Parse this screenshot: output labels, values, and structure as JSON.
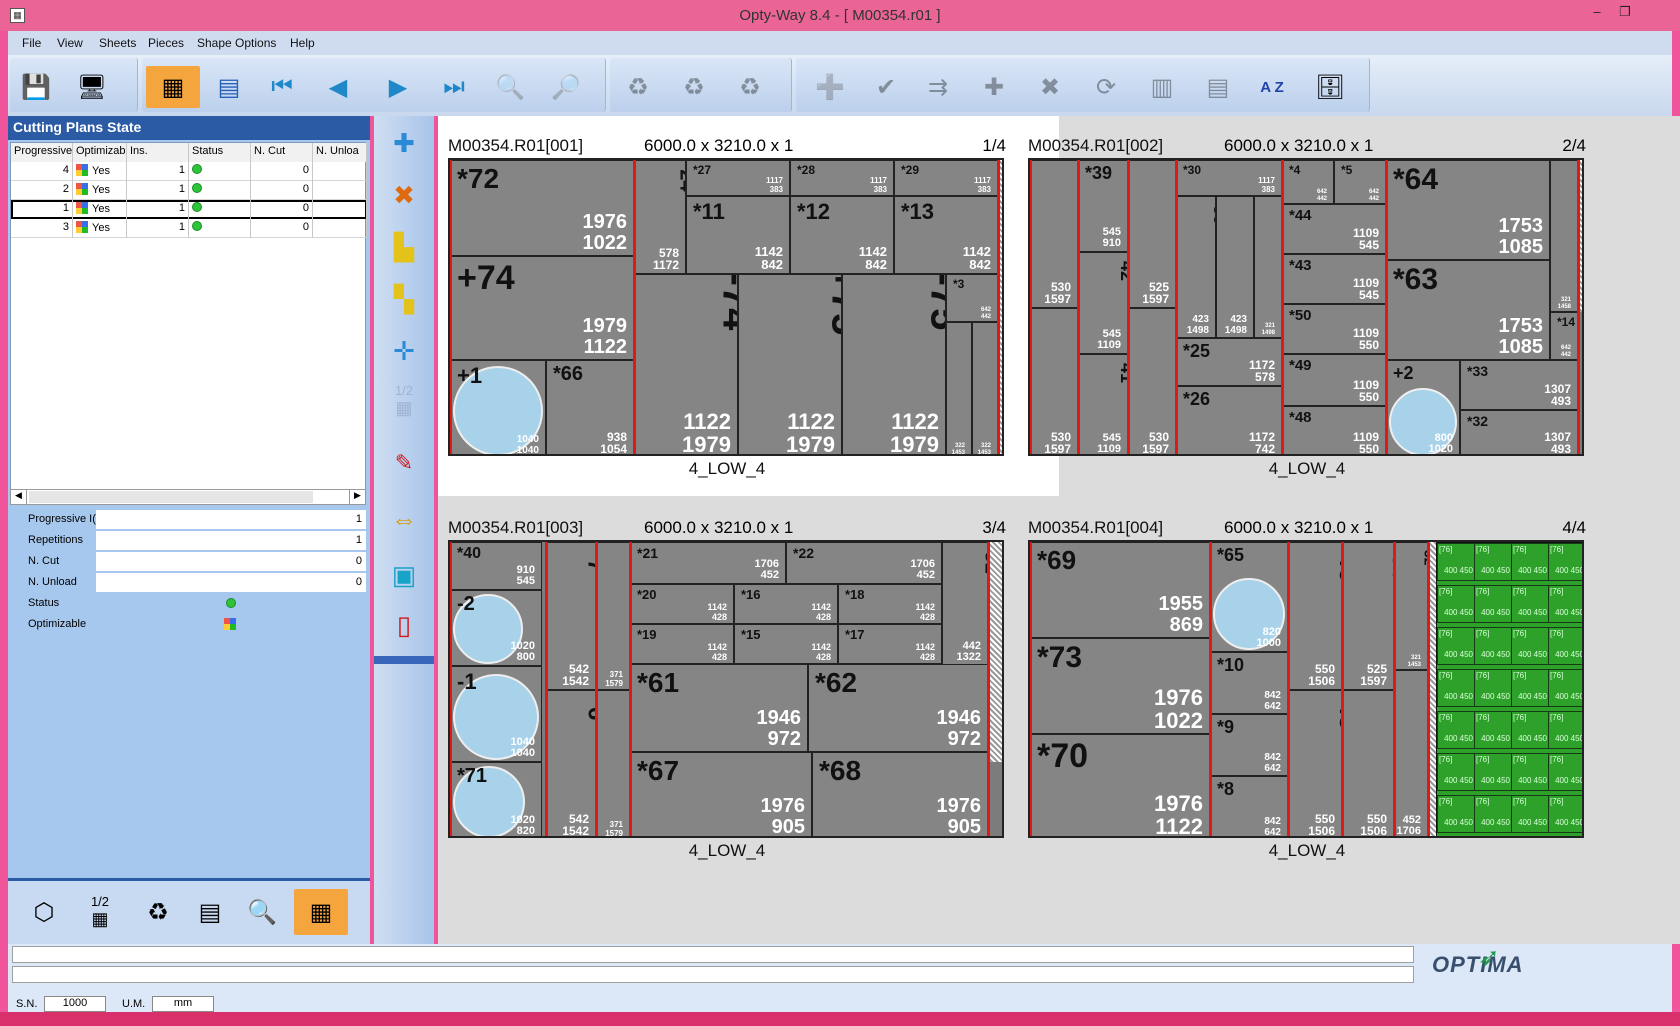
{
  "window": {
    "title": "Opty-Way 8.4  - [ M00354.r01 ]",
    "min": "–",
    "max": "❐"
  },
  "menu": [
    "File",
    "View",
    "Sheets",
    "Pieces",
    "Shape Options",
    "Help"
  ],
  "left": {
    "header": "Cutting Plans State",
    "columns": [
      "Progressive",
      "Optimizable",
      "Ins.",
      "Status",
      "N. Cut",
      "N. Unloa"
    ],
    "rows": [
      {
        "prog": "4",
        "opt": "Yes",
        "ins": "1",
        "cut": "0"
      },
      {
        "prog": "2",
        "opt": "Yes",
        "ins": "1",
        "cut": "0"
      },
      {
        "prog": "1",
        "opt": "Yes",
        "ins": "1",
        "cut": "0"
      },
      {
        "prog": "3",
        "opt": "Yes",
        "ins": "1",
        "cut": "0"
      }
    ],
    "props": [
      {
        "label": "Progressive I(",
        "value": "1"
      },
      {
        "label": "Repetitions",
        "value": "1"
      },
      {
        "label": "N. Cut",
        "value": "0"
      },
      {
        "label": "N. Unload",
        "value": "0"
      },
      {
        "label": "Status",
        "value": ""
      },
      {
        "label": "Optimizable",
        "value": ""
      }
    ],
    "bottom_half": "1/2"
  },
  "vtool_half": "1/2",
  "plans": [
    {
      "id": "M00354.R01[001]",
      "size": "6000.0 x  3210.0 x 1",
      "page": "1/4",
      "foot": "4_LOW_4"
    },
    {
      "id": "M00354.R01[002]",
      "size": "6000.0 x  3210.0 x 1",
      "page": "2/4",
      "foot": "4_LOW_4"
    },
    {
      "id": "M00354.R01[003]",
      "size": "6000.0 x  3210.0 x 1",
      "page": "3/4",
      "foot": "4_LOW_4"
    },
    {
      "id": "M00354.R01[004]",
      "size": "6000.0 x  3210.0 x 1",
      "page": "4/4",
      "foot": "4_LOW_4"
    }
  ],
  "pieces1": [
    {
      "id": "*72",
      "w": "1976",
      "h": "1022"
    },
    {
      "id": "+74",
      "w": "1979",
      "h": "1122"
    },
    {
      "id": "+1",
      "w": "1040",
      "h": "1040"
    },
    {
      "id": "*66",
      "w": "938",
      "h": "1054"
    },
    {
      "id": "*24",
      "w": "578",
      "h": "1172"
    },
    {
      "id": "*27",
      "w": "1117",
      "h": "383"
    },
    {
      "id": "*28",
      "w": "1117",
      "h": "383"
    },
    {
      "id": "*29",
      "w": "1117",
      "h": "383"
    },
    {
      "id": "*11",
      "w": "1142",
      "h": "842"
    },
    {
      "id": "*12",
      "w": "1142",
      "h": "842"
    },
    {
      "id": "*13",
      "w": "1142",
      "h": "842"
    },
    {
      "id": "-74",
      "w": "1122",
      "h": "1979"
    },
    {
      "id": "+75",
      "w": "1122",
      "h": "1979"
    },
    {
      "id": "-75",
      "w": "1122",
      "h": "1979"
    },
    {
      "id": "*3",
      "w": "642",
      "h": "442"
    },
    {
      "id": "*55",
      "w": "322",
      "h": "1453"
    },
    {
      "id": "*56",
      "w": "322",
      "h": "1453"
    }
  ],
  "pieces2": [
    {
      "id": "*37",
      "w": "530",
      "h": "1597"
    },
    {
      "id": "*36",
      "w": "530",
      "h": "1597"
    },
    {
      "id": "*39",
      "w": "545",
      "h": "910"
    },
    {
      "id": "*42",
      "w": "545",
      "h": "1109"
    },
    {
      "id": "*41",
      "w": "545",
      "h": "1109"
    },
    {
      "id": "*34",
      "w": "525",
      "h": "1597"
    },
    {
      "id": "*38",
      "w": "530",
      "h": "1597"
    },
    {
      "id": "*30",
      "w": "1117",
      "h": "383"
    },
    {
      "id": "*59",
      "w": "423",
      "h": "1498"
    },
    {
      "id": "*60",
      "w": "423",
      "h": "1498"
    },
    {
      "id": "*53",
      "w": "321",
      "h": "1498"
    },
    {
      "id": "*25",
      "w": "1172",
      "h": "578"
    },
    {
      "id": "*26",
      "w": "1172",
      "h": "742"
    },
    {
      "id": "*4",
      "w": "642",
      "h": "442"
    },
    {
      "id": "*5",
      "w": "642",
      "h": "442"
    },
    {
      "id": "*44",
      "w": "1109",
      "h": "545"
    },
    {
      "id": "*43",
      "w": "1109",
      "h": "545"
    },
    {
      "id": "*50",
      "w": "1109",
      "h": "550"
    },
    {
      "id": "*49",
      "w": "1109",
      "h": "550"
    },
    {
      "id": "*48",
      "w": "1109",
      "h": "550"
    },
    {
      "id": "*64",
      "w": "1753",
      "h": "1085"
    },
    {
      "id": "*63",
      "w": "1753",
      "h": "1085"
    },
    {
      "id": "*54",
      "w": "321",
      "h": "1458"
    },
    {
      "id": "*14",
      "w": "642",
      "h": "442"
    },
    {
      "id": "+2",
      "w": "800",
      "h": "1020"
    },
    {
      "id": "*33",
      "w": "1307",
      "h": "493"
    },
    {
      "id": "*32",
      "w": "1307",
      "h": "493"
    }
  ],
  "pieces3": [
    {
      "id": "*40",
      "w": "910",
      "h": "545"
    },
    {
      "id": "-2",
      "w": "1020",
      "h": "800"
    },
    {
      "id": "-1",
      "w": "1040",
      "h": "1040"
    },
    {
      "id": "*71",
      "w": "1020",
      "h": "820"
    },
    {
      "id": "*7",
      "w": "542",
      "h": "1542"
    },
    {
      "id": "*6",
      "w": "542",
      "h": "1542"
    },
    {
      "id": "*58",
      "w": "371",
      "h": "1579"
    },
    {
      "id": "*57",
      "w": "371",
      "h": "1579"
    },
    {
      "id": "*21",
      "w": "1706",
      "h": "452"
    },
    {
      "id": "*22",
      "w": "1706",
      "h": "452"
    },
    {
      "id": "*31",
      "w": "442",
      "h": "1322"
    },
    {
      "id": "*20",
      "w": "1142",
      "h": "428"
    },
    {
      "id": "*16",
      "w": "1142",
      "h": "428"
    },
    {
      "id": "*18",
      "w": "1142",
      "h": "428"
    },
    {
      "id": "*19",
      "w": "1142",
      "h": "428"
    },
    {
      "id": "*15",
      "w": "1142",
      "h": "428"
    },
    {
      "id": "*17",
      "w": "1142",
      "h": "428"
    },
    {
      "id": "*61",
      "w": "1946",
      "h": "972"
    },
    {
      "id": "*62",
      "w": "1946",
      "h": "972"
    },
    {
      "id": "*67",
      "w": "1976",
      "h": "905"
    },
    {
      "id": "*68",
      "w": "1976",
      "h": "905"
    }
  ],
  "pieces4": [
    {
      "id": "*69",
      "w": "1955",
      "h": "869"
    },
    {
      "id": "*73",
      "w": "1976",
      "h": "1022"
    },
    {
      "id": "*70",
      "w": "1976",
      "h": "1122"
    },
    {
      "id": "*65",
      "w": "820",
      "h": "1000"
    },
    {
      "id": "*10",
      "w": "842",
      "h": "642"
    },
    {
      "id": "*9",
      "w": "842",
      "h": "642"
    },
    {
      "id": "*8",
      "w": "842",
      "h": "642"
    },
    {
      "id": "*46",
      "w": "550",
      "h": "1506"
    },
    {
      "id": "*45",
      "w": "550",
      "h": "1506"
    },
    {
      "id": "*35",
      "w": "525",
      "h": "1597"
    },
    {
      "id": "*47",
      "w": "550",
      "h": "1506"
    },
    {
      "id": "*52",
      "w": "321",
      "h": "1453"
    },
    {
      "id": "*23",
      "w": "452",
      "h": "1706"
    }
  ],
  "green_label": "[76]",
  "green_dims": "400 450",
  "status": {
    "sn_label": "S.N.",
    "sn": "1000",
    "um_label": "U.M.",
    "um": "mm",
    "logo": "OPTIMA"
  },
  "colors": {
    "sheet": "#858585",
    "cut": "#e21818",
    "circle": "#a8d2ea",
    "accent": "#f5a53d",
    "header": "#2c5ba6"
  }
}
